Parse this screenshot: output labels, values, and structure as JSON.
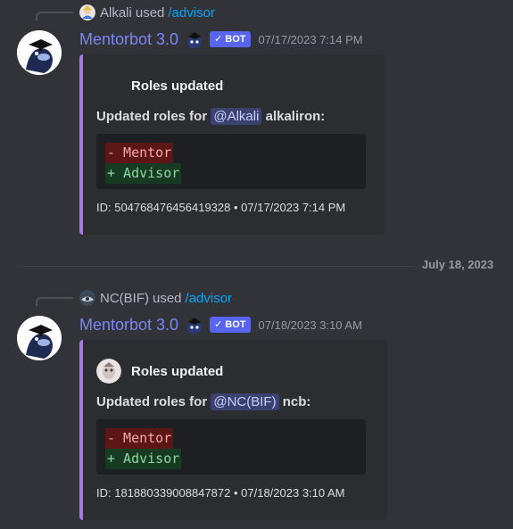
{
  "messages": [
    {
      "reply": {
        "user": "Alkali",
        "used": "used",
        "command": "/advisor"
      },
      "bot": {
        "name": "Mentorbot 3.0",
        "badge": "BOT",
        "check": "✓",
        "timestamp": "07/17/2023 7:14 PM"
      },
      "embed": {
        "author": "Roles updated",
        "desc_prefix": "Updated roles for",
        "mention": "@Alkali",
        "username": "alkaliron:",
        "diff_removed": "- Mentor",
        "diff_added": "+ Advisor",
        "footer": "ID: 504768476456419328 • 07/17/2023 7:14 PM"
      }
    },
    {
      "reply": {
        "user": "NC(BIF)",
        "used": "used",
        "command": "/advisor"
      },
      "bot": {
        "name": "Mentorbot 3.0",
        "badge": "BOT",
        "check": "✓",
        "timestamp": "07/18/2023 3:10 AM"
      },
      "embed": {
        "author": "Roles updated",
        "desc_prefix": "Updated roles for",
        "mention": "@NC(BIF)",
        "username": "ncb:",
        "diff_removed": "- Mentor",
        "diff_added": "+ Advisor",
        "footer": "ID: 181880339008847872 • 07/18/2023 3:10 AM"
      }
    }
  ],
  "date_divider": "July 18, 2023",
  "colors": {
    "background": "#313338",
    "embed_bg": "#2b2d31",
    "embed_accent": "#a57cdc",
    "bot_name": "#7a86f8",
    "badge": "#5865f2",
    "command_link": "#00a8fc",
    "mention_bg": "#3c4270"
  }
}
